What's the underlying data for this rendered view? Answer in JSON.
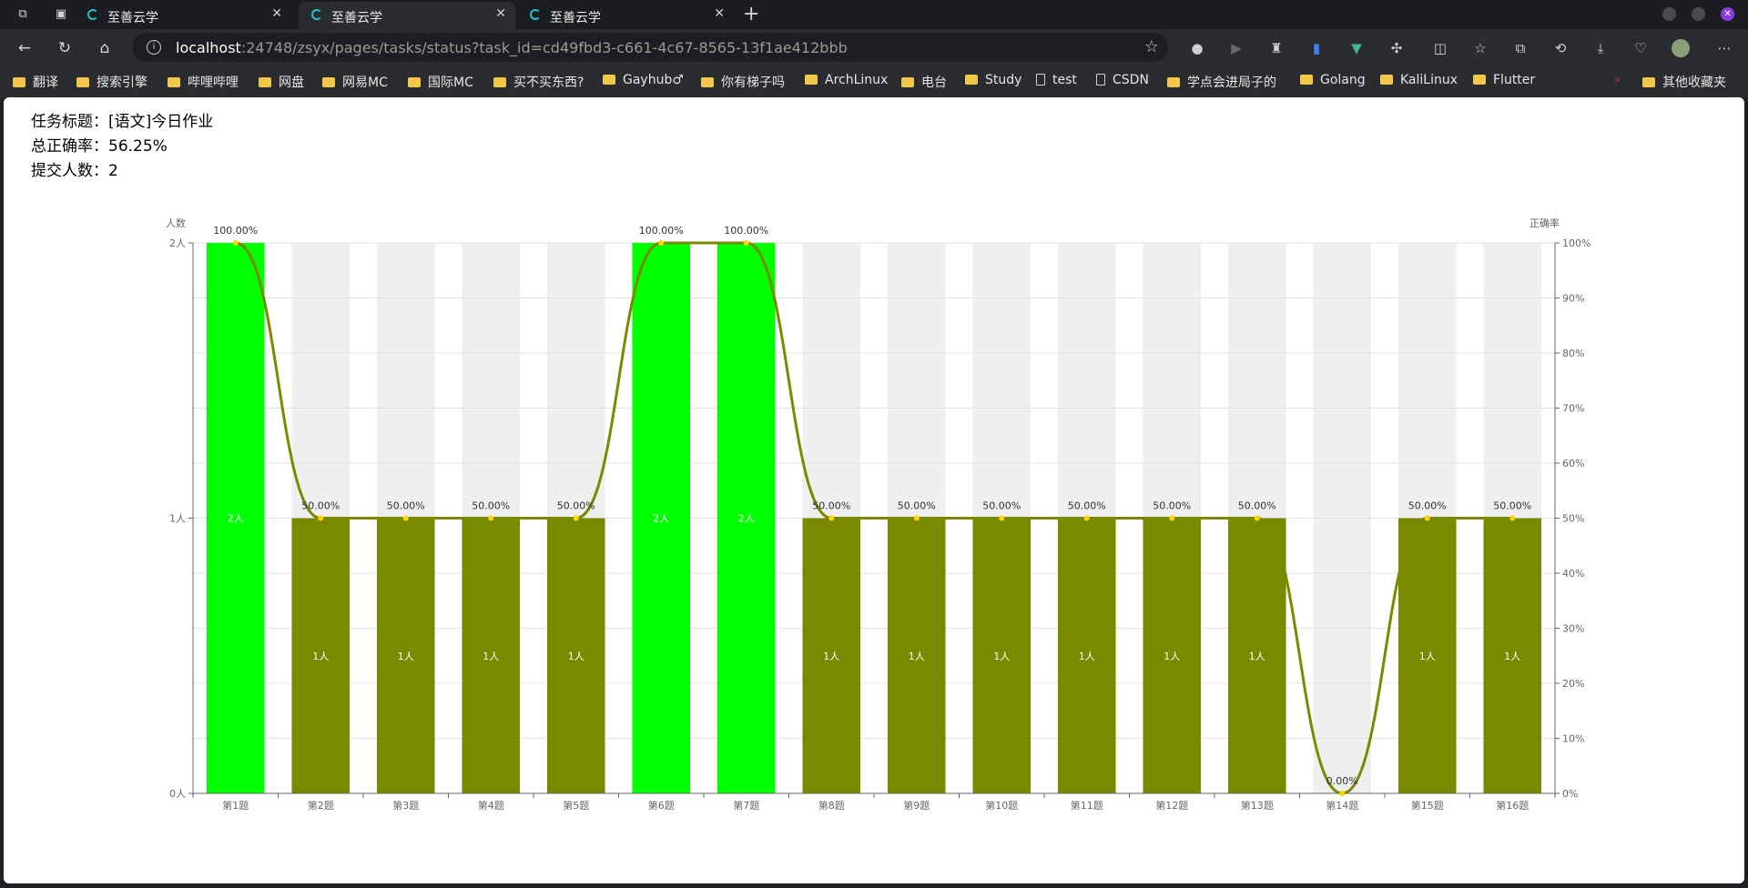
{
  "browser": {
    "tabs": [
      {
        "title": "至善云学"
      },
      {
        "title": "至善云学"
      },
      {
        "title": "至善云学"
      }
    ],
    "url_host": "localhost",
    "url_rest": ":24748/zsyx/pages/tasks/status?task_id=cd49fbd3-c661-4c67-8565-13f1ae412bbb",
    "bookmarks": [
      "翻译",
      "搜索引擎",
      "哔哩哔哩",
      "网盘",
      "网易MC",
      "国际MC",
      "买不买东西?",
      "Gayhub♂",
      "你有梯子吗",
      "ArchLinux",
      "电台",
      "Study",
      "test",
      "CSDN",
      "学点会进局子的",
      "Golang",
      "KaliLinux",
      "Flutter"
    ],
    "other_bookmarks": "其他收藏夹"
  },
  "page": {
    "task_title": "任务标题：[语文]今日作业",
    "total_accuracy": "总正确率：56.25%",
    "submit_count": "提交人数：2"
  },
  "chart_data": {
    "type": "bar",
    "categories": [
      "第1题",
      "第2题",
      "第3题",
      "第4题",
      "第5题",
      "第6题",
      "第7题",
      "第8题",
      "第9题",
      "第10题",
      "第11题",
      "第12题",
      "第13题",
      "第14题",
      "第15题",
      "第16题"
    ],
    "series": [
      {
        "values": [
          2,
          1,
          1,
          1,
          1,
          2,
          2,
          1,
          1,
          1,
          1,
          1,
          1,
          0,
          1,
          1
        ]
      },
      {
        "values": [
          100,
          50,
          50,
          50,
          50,
          100,
          100,
          50,
          50,
          50,
          50,
          50,
          50,
          0,
          50,
          50
        ]
      }
    ],
    "bar_labels": [
      "2人",
      "1人",
      "1人",
      "1人",
      "1人",
      "2人",
      "2人",
      "1人",
      "1人",
      "1人",
      "1人",
      "1人",
      "1人",
      "",
      "1人",
      "1人"
    ],
    "line_labels": [
      "100.00%",
      "50.00%",
      "50.00%",
      "50.00%",
      "50.00%",
      "100.00%",
      "100.00%",
      "50.00%",
      "50.00%",
      "50.00%",
      "50.00%",
      "50.00%",
      "50.00%",
      "0.00%",
      "50.00%",
      "50.00%"
    ],
    "ylabel_left": "人数",
    "ylabel_right": "正确率",
    "yticks_left": [
      "0人",
      "1人",
      "2人"
    ],
    "yticks_right": [
      "0%",
      "10%",
      "20%",
      "30%",
      "40%",
      "50%",
      "60%",
      "70%",
      "80%",
      "90%",
      "100%"
    ],
    "ylim_left": [
      0,
      2
    ],
    "ylim_right": [
      0,
      100
    ],
    "colors": {
      "full": "#00ff00",
      "partial": "#7a8a00",
      "line": "#7a8a00",
      "band": "#efefef",
      "point": "#ffd500"
    }
  }
}
